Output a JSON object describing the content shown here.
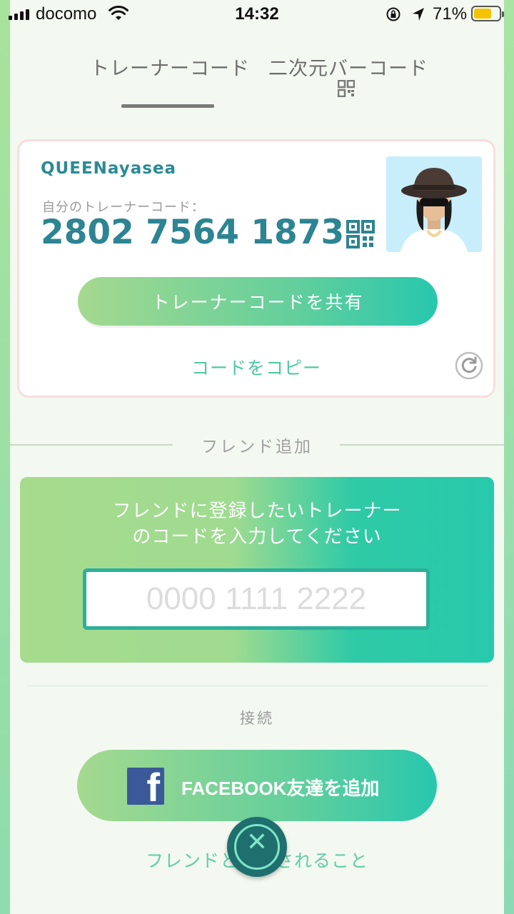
{
  "status_bar": {
    "carrier": "docomo",
    "time": "14:32",
    "battery_percent": "71%",
    "battery_level": 0.71,
    "icons": [
      "signal-icon",
      "wifi-icon",
      "orientation-lock-icon",
      "location-arrow-icon",
      "battery-icon"
    ]
  },
  "tabs": [
    {
      "label": "トレーナーコード",
      "active": true
    },
    {
      "label": "二次元バーコード",
      "active": false,
      "icon": "qr-code-icon"
    }
  ],
  "trainer_card": {
    "name": "QUEENayasea",
    "code_caption": "自分のトレーナーコード：",
    "code": "2802 7564 1873",
    "share_label": "トレーナーコードを共有",
    "copy_label": "コードをコピー"
  },
  "add_friend": {
    "section_title": "フレンド追加",
    "prompt": "フレンドに登録したいトレーナーのコードを入力してください",
    "input_placeholder": "0000 1111 2222",
    "input_value": ""
  },
  "connect": {
    "label": "接続",
    "facebook_label": "FACEBOOK友達を追加"
  },
  "footer": {
    "benefits_link": "フレンドと　　されること"
  },
  "colors": {
    "accent_teal": "#2d8492",
    "mint": "#4fc7a2",
    "gradient_start": "#a5d98f",
    "gradient_end": "#28c7ae",
    "facebook_blue": "#3b5998",
    "battery_yellow": "#f5c400"
  }
}
